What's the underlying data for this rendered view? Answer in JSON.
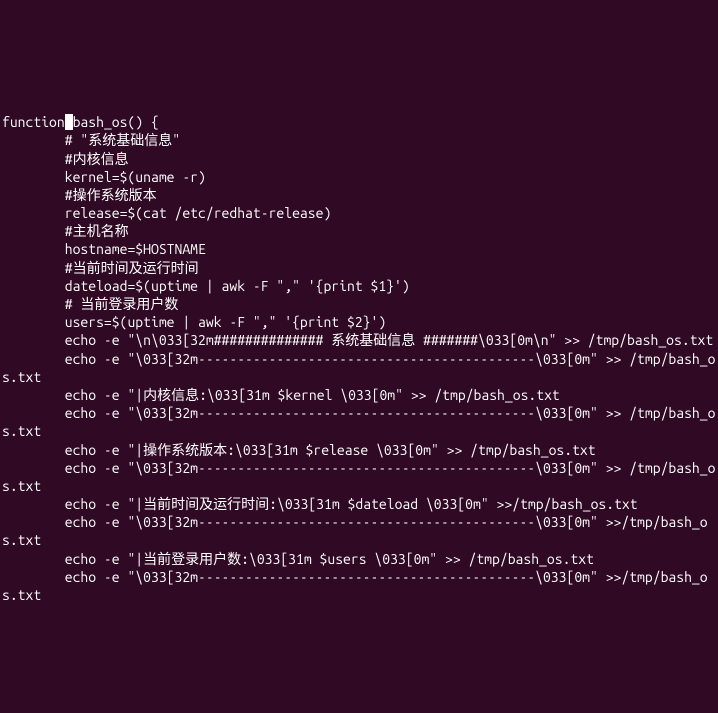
{
  "code_lines": [
    "function bash_os() {",
    "        # \"系统基础信息\"",
    "        #内核信息",
    "        kernel=$(uname -r)",
    "        #操作系统版本",
    "        release=$(cat /etc/redhat-release)",
    "        #主机名称",
    "        hostname=$HOSTNAME",
    "        #当前时间及运行时间",
    "        dateload=$(uptime | awk -F \",\" '{print $1}')",
    "        # 当前登录用户数",
    "        users=$(uptime | awk -F \",\" '{print $2}')",
    "        echo -e \"\\n\\033[32m############## 系统基础信息 #######\\033[0m\\n\" >> /tmp/bash_os.txt",
    "        echo -e \"\\033[32m-------------------------------------------\\033[0m\" >> /tmp/bash_os.txt",
    "        echo -e \"|内核信息:\\033[31m $kernel \\033[0m\" >> /tmp/bash_os.txt",
    "        echo -e \"\\033[32m-------------------------------------------\\033[0m\" >> /tmp/bash_os.txt",
    "        echo -e \"|操作系统版本:\\033[31m $release \\033[0m\" >> /tmp/bash_os.txt",
    "        echo -e \"\\033[32m-------------------------------------------\\033[0m\" >> /tmp/bash_os.txt",
    "        echo -e \"|当前时间及运行时间:\\033[31m $dateload \\033[0m\" >>/tmp/bash_os.txt",
    "        echo -e \"\\033[32m-------------------------------------------\\033[0m\" >>/tmp/bash_os.txt",
    "        echo -e \"|当前登录用户数:\\033[31m $users \\033[0m\" >> /tmp/bash_os.txt",
    "        echo -e \"\\033[32m-------------------------------------------\\033[0m\" >>/tmp/bash_os.txt"
  ],
  "cursor_position": {
    "line": 0,
    "char": 8
  }
}
